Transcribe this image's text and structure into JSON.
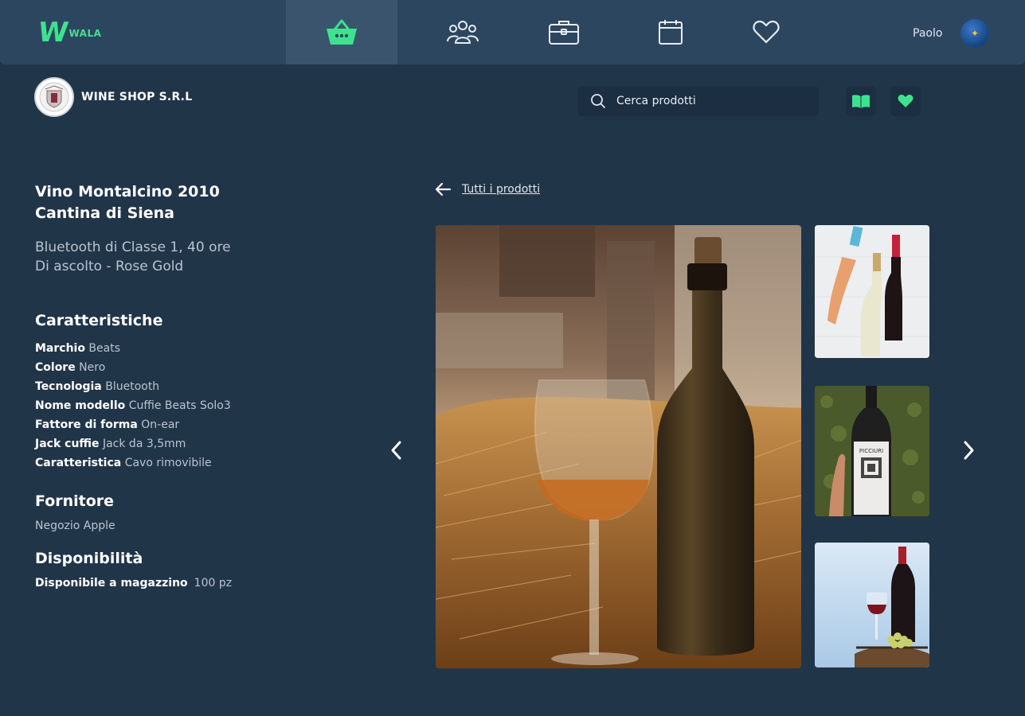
{
  "brand": {
    "logo_text": "WALA"
  },
  "nav": {
    "items": [
      {
        "name": "shop",
        "icon": "basket-icon",
        "active": true
      },
      {
        "name": "community",
        "icon": "people-icon",
        "active": false
      },
      {
        "name": "work",
        "icon": "briefcase-icon",
        "active": false
      },
      {
        "name": "calendar",
        "icon": "calendar-icon",
        "active": false
      },
      {
        "name": "favorites",
        "icon": "heart-icon",
        "active": false
      }
    ],
    "user_name": "Paolo"
  },
  "shop": {
    "name": "WINE SHOP S.R.L",
    "search_placeholder": "Cerca prodotti"
  },
  "product": {
    "title_line1": "Vino Montalcino 2010",
    "title_line2": "Cantina di Siena",
    "subtitle_line1": "Bluetooth di Classe 1, 40 ore",
    "subtitle_line2": "Di ascolto - Rose Gold",
    "features_title": "Caratteristiche",
    "features": [
      {
        "label": "Marchio",
        "value": "Beats"
      },
      {
        "label": "Colore",
        "value": "Nero"
      },
      {
        "label": "Tecnologia",
        "value": "Bluetooth"
      },
      {
        "label": "Nome modello",
        "value": "Cuffie Beats Solo3"
      },
      {
        "label": "Fattore di forma",
        "value": "On-ear"
      },
      {
        "label": "Jack cuffie",
        "value": "Jack da 3,5mm"
      },
      {
        "label": "Caratteristica",
        "value": "Cavo rimovibile"
      }
    ],
    "supplier_title": "Fornitore",
    "supplier": "Negozio Apple",
    "availability_title": "Disponibilità",
    "availability_label": "Disponibile a magazzino",
    "availability_value": "100 pz"
  },
  "gallery": {
    "back_label": "Tutti i prodotti",
    "qr_label": "PICCIURI"
  },
  "colors": {
    "accent": "#3ee28e",
    "background": "#213549",
    "topbar": "#2d4660"
  }
}
